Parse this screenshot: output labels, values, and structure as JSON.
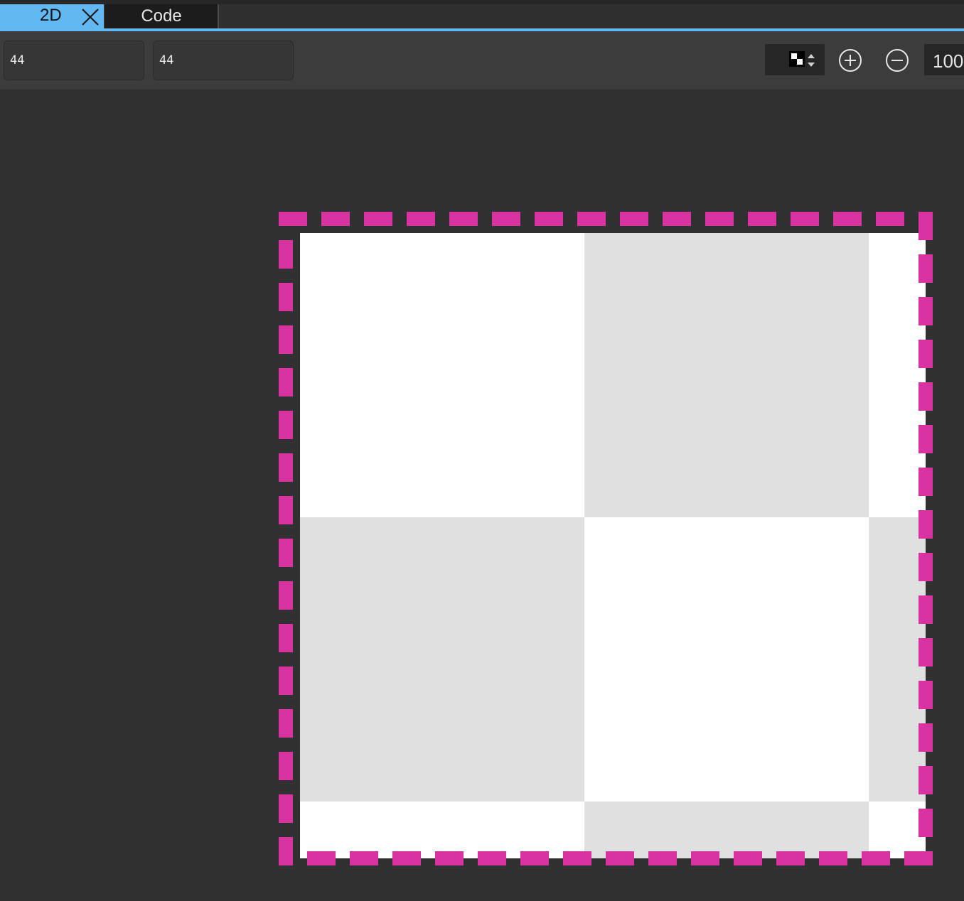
{
  "tabs": [
    {
      "label": "2D",
      "active": true
    },
    {
      "label": "Code",
      "active": false
    }
  ],
  "toolbar": {
    "field_a_value": "44",
    "field_b_value": "44",
    "zoom_value": "100"
  },
  "icons": {
    "tab_close": "close-icon",
    "background": "checker-swatch-icon",
    "zoom_in": "plus-circle-icon",
    "zoom_out": "minus-circle-icon"
  },
  "colors": {
    "accent": "#61b7f0",
    "selection": "#d933a3",
    "checker_light": "#ffffff",
    "checker_dark": "#e0e0e0"
  }
}
